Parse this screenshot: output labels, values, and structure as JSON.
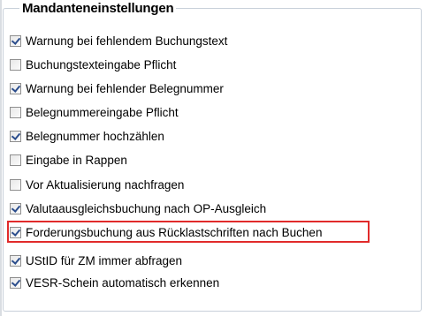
{
  "group": {
    "title": "Mandanteneinstellungen"
  },
  "options": [
    {
      "label": "Warnung bei fehlendem Buchungstext",
      "checked": true
    },
    {
      "label": "Buchungstexteingabe Pflicht",
      "checked": false
    },
    {
      "label": "Warnung bei fehlender Belegnummer",
      "checked": true
    },
    {
      "label": "Belegnummereingabe Pflicht",
      "checked": false
    },
    {
      "label": "Belegnummer hochzählen",
      "checked": true
    },
    {
      "label": "Eingabe in Rappen",
      "checked": false
    },
    {
      "label": "Vor Aktualisierung nachfragen",
      "checked": false
    },
    {
      "label": "Valutaausgleichsbuchung nach OP-Ausgleich",
      "checked": true
    },
    {
      "label": "Forderungsbuchung aus Rücklastschriften nach Buchen",
      "checked": true,
      "highlighted": true
    },
    {
      "label": "UStID für ZM immer abfragen",
      "checked": true
    },
    {
      "label": "VESR-Schein automatisch erkennen",
      "checked": true
    }
  ],
  "colors": {
    "highlight": "#e12a2a",
    "check": "#2b4d8c"
  }
}
